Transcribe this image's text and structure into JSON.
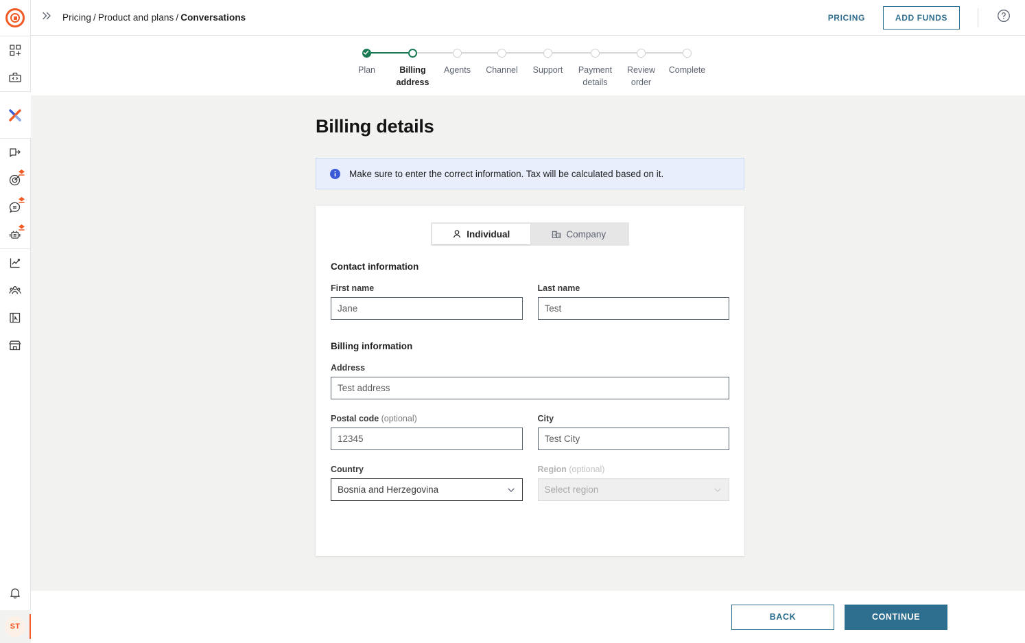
{
  "app": {
    "logo_icon": "target-logo-icon",
    "accent_color": "#f15a24",
    "primary_button_color": "#2e6e8e",
    "step_done_color": "#1b7a53"
  },
  "topbar": {
    "collapse_icon": "chevron-double-right-icon",
    "breadcrumb": [
      {
        "label": "Pricing",
        "current": false
      },
      {
        "label": "Product and plans",
        "current": false
      },
      {
        "label": "Conversations",
        "current": true
      }
    ],
    "separator": "/",
    "pricing_link": "PRICING",
    "add_funds_button": "ADD FUNDS",
    "help_icon": "question-circle-icon"
  },
  "sidebar": {
    "groups": [
      {
        "items": [
          {
            "name": "apps-add-icon",
            "badge": false
          },
          {
            "name": "developer-toolbox-icon",
            "badge": false
          }
        ]
      },
      {
        "items": [
          {
            "name": "livechat-x-logo-icon",
            "badge": false,
            "active": true
          }
        ]
      },
      {
        "items": [
          {
            "name": "open-widget-icon",
            "badge": false
          },
          {
            "name": "target-goal-icon",
            "badge": true
          },
          {
            "name": "chat-bubble-icon",
            "badge": true
          },
          {
            "name": "chatbot-icon",
            "badge": true
          }
        ]
      },
      {
        "items": [
          {
            "name": "analytics-chart-icon",
            "badge": false
          },
          {
            "name": "team-people-icon",
            "badge": false
          },
          {
            "name": "cursor-panel-icon",
            "badge": false
          },
          {
            "name": "marketplace-store-icon",
            "badge": false
          }
        ]
      }
    ],
    "bell_icon": "notifications-bell-icon",
    "avatar_initials": "ST"
  },
  "stepper": {
    "steps": [
      {
        "label": "Plan",
        "state": "done"
      },
      {
        "label": "Billing address",
        "state": "current"
      },
      {
        "label": "Agents",
        "state": "todo"
      },
      {
        "label": "Channel",
        "state": "todo"
      },
      {
        "label": "Support",
        "state": "todo"
      },
      {
        "label": "Payment details",
        "state": "todo"
      },
      {
        "label": "Review order",
        "state": "todo"
      },
      {
        "label": "Complete",
        "state": "todo"
      }
    ]
  },
  "main": {
    "page_title": "Billing details",
    "banner": {
      "icon": "info-circle-icon",
      "text": "Make sure to enter the correct information. Tax will be calculated based on it."
    },
    "tabs": [
      {
        "label": "Individual",
        "icon": "person-icon",
        "active": true
      },
      {
        "label": "Company",
        "icon": "building-icon",
        "active": false
      }
    ],
    "contact_section": {
      "title": "Contact information",
      "first_name": {
        "label": "First name",
        "value": "Jane",
        "placeholder": "Jane"
      },
      "last_name": {
        "label": "Last name",
        "value": "Test",
        "placeholder": "Test"
      }
    },
    "billing_section": {
      "title": "Billing information",
      "address": {
        "label": "Address",
        "value": "Test address",
        "placeholder": "Test address"
      },
      "postal_code": {
        "label": "Postal code",
        "optional_suffix": " (optional)",
        "value": "12345",
        "placeholder": "12345"
      },
      "city": {
        "label": "City",
        "value": "Test City",
        "placeholder": "Test City"
      },
      "country": {
        "label": "Country",
        "value": "Bosnia and Herzegovina",
        "caret_icon": "chevron-down-icon"
      },
      "region": {
        "label": "Region",
        "optional_suffix": " (optional)",
        "value": "Select region",
        "caret_icon": "chevron-down-icon",
        "disabled": true
      }
    }
  },
  "footer": {
    "back_button": "BACK",
    "continue_button": "CONTINUE"
  }
}
